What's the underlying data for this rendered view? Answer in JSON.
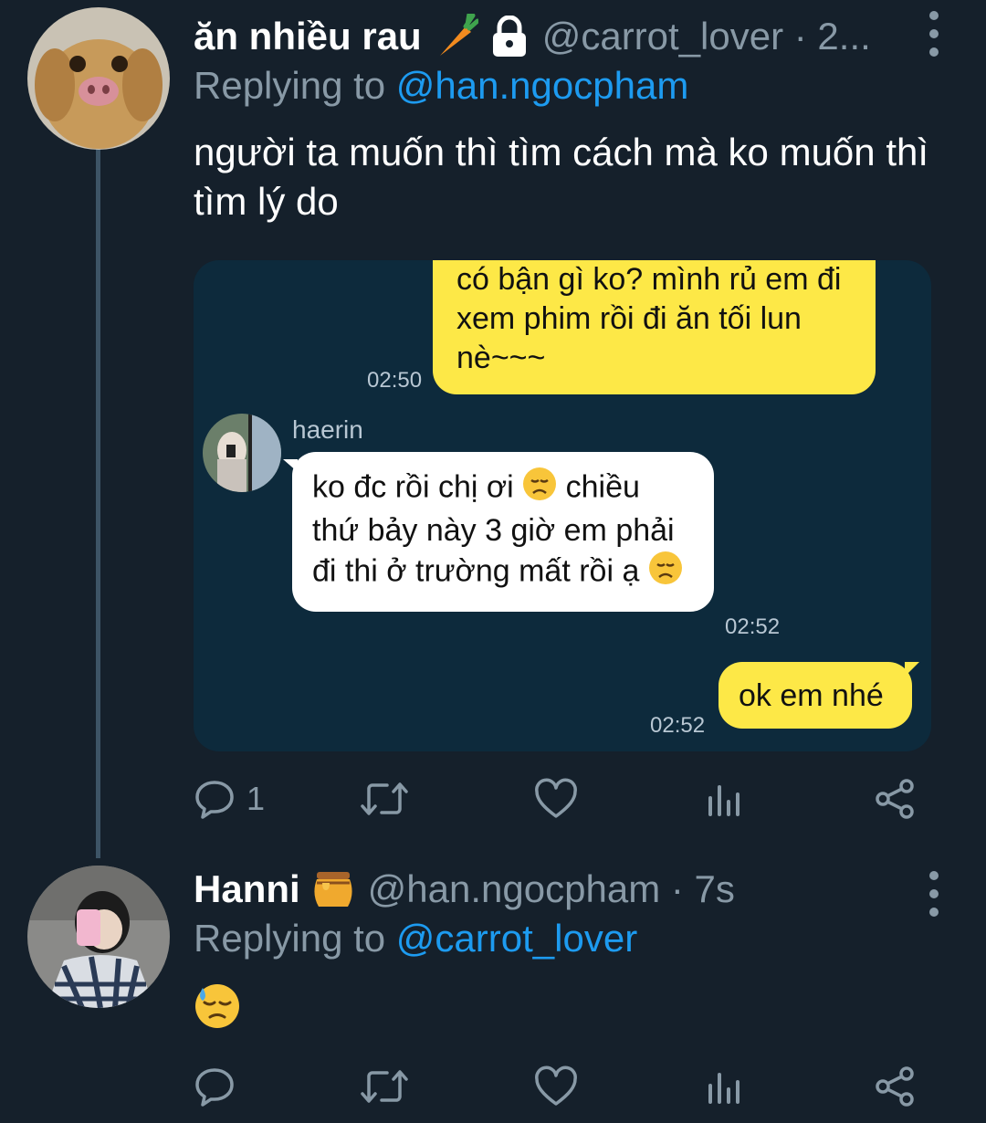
{
  "tweets": [
    {
      "display_name": "ăn nhiều rau",
      "name_emojis": [
        "carrot-icon",
        "lock-icon"
      ],
      "handle": "@carrot_lover · 2...",
      "reply_prefix": "Replying to ",
      "reply_to": "@han.ngocpham",
      "text": "người ta muốn thì tìm cách mà ko muốn thì tìm lý do",
      "reply_count": "1",
      "media": {
        "messages": [
          {
            "sender": "self",
            "text": "có bận gì ko? mình rủ em đi xem phim rồi đi ăn tối lun nè~~~",
            "time": "02:50"
          },
          {
            "sender": "haerin",
            "text_a": "ko đc rồi chị ơi ",
            "text_b": " chiều thứ bảy này 3 giờ em phải đi thi ở trường mất rồi ạ ",
            "time": "02:52"
          },
          {
            "sender": "self",
            "text": "ok em nhé",
            "time": "02:52"
          }
        ],
        "contact_name": "haerin"
      }
    },
    {
      "display_name": "Hanni",
      "name_emojis": [
        "honey-pot-icon"
      ],
      "handle": "@han.ngocpham · 7s",
      "reply_prefix": "Replying to ",
      "reply_to": "@carrot_lover",
      "text_emoji": "downcast-sweat-face-icon"
    }
  ],
  "colors": {
    "background": "#15202b",
    "secondary_text": "#8899a6",
    "mention": "#1d9bf0",
    "chat_bg": "#0d2a3c",
    "bubble_self": "#fde847",
    "bubble_other": "#ffffff"
  }
}
